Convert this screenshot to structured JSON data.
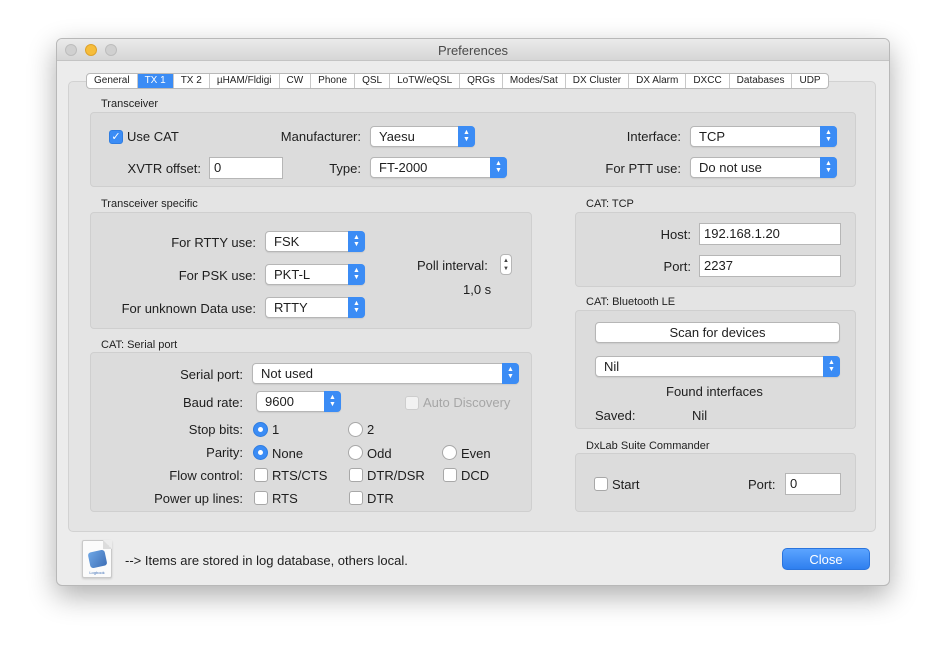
{
  "window": {
    "title": "Preferences"
  },
  "tabs": [
    {
      "label": "General"
    },
    {
      "label": "TX 1"
    },
    {
      "label": "TX 2"
    },
    {
      "label": "µHAM/Fldigi"
    },
    {
      "label": "CW"
    },
    {
      "label": "Phone"
    },
    {
      "label": "QSL"
    },
    {
      "label": "LoTW/eQSL"
    },
    {
      "label": "QRGs"
    },
    {
      "label": "Modes/Sat"
    },
    {
      "label": "DX Cluster"
    },
    {
      "label": "DX Alarm"
    },
    {
      "label": "DXCC"
    },
    {
      "label": "Databases"
    },
    {
      "label": "UDP"
    }
  ],
  "active_tab": "TX 1",
  "transceiver": {
    "section": "Transceiver",
    "use_cat_label": "Use CAT",
    "use_cat_checked": true,
    "manufacturer_label": "Manufacturer:",
    "manufacturer_value": "Yaesu",
    "interface_label": "Interface:",
    "interface_value": "TCP",
    "xvtr_label": "XVTR offset:",
    "xvtr_value": "0",
    "type_label": "Type:",
    "type_value": "FT-2000",
    "ptt_label": "For PTT use:",
    "ptt_value": "Do not use"
  },
  "specific": {
    "section": "Transceiver specific",
    "rtty_label": "For RTTY use:",
    "rtty_value": "FSK",
    "psk_label": "For PSK use:",
    "psk_value": "PKT-L",
    "unknown_label": "For unknown Data use:",
    "unknown_value": "RTTY",
    "poll_label": "Poll interval:",
    "poll_value": "1,0 s"
  },
  "serial": {
    "section": "CAT: Serial port",
    "port_label": "Serial port:",
    "port_value": "Not used",
    "baud_label": "Baud rate:",
    "baud_value": "9600",
    "auto_label": "Auto Discovery",
    "stop_label": "Stop bits:",
    "stop_options": [
      "1",
      "2"
    ],
    "parity_label": "Parity:",
    "parity_options": [
      "None",
      "Odd",
      "Even"
    ],
    "flow_label": "Flow control:",
    "flow_options": [
      "RTS/CTS",
      "DTR/DSR",
      "DCD"
    ],
    "power_label": "Power up lines:",
    "power_options": [
      "RTS",
      "DTR"
    ]
  },
  "tcp": {
    "section": "CAT: TCP",
    "host_label": "Host:",
    "host_value": "192.168.1.20",
    "port_label": "Port:",
    "port_value": "2237"
  },
  "bluetooth": {
    "section": "CAT: Bluetooth LE",
    "scan_label": "Scan for devices",
    "device_value": "Nil",
    "found_label": "Found interfaces",
    "saved_label": "Saved:",
    "saved_value": "Nil"
  },
  "dxlab": {
    "section": "DxLab Suite Commander",
    "start_label": "Start",
    "port_label": "Port:",
    "port_value": "0"
  },
  "footer": {
    "note": "--> Items are stored in log database, others local.",
    "icon_caption": "Logbook",
    "close_label": "Close"
  },
  "colors": {
    "accent": "#3b8cf5"
  }
}
